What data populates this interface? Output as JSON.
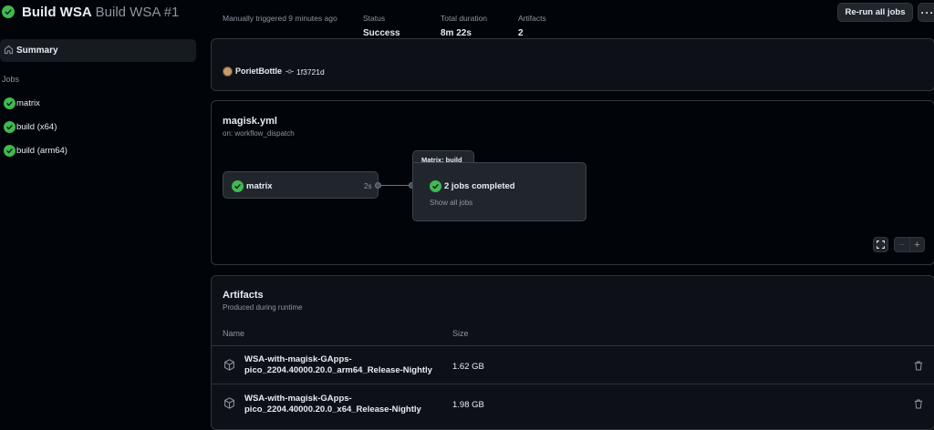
{
  "header": {
    "title": "Build WSA",
    "subtitle": "Build WSA #1",
    "rerun_label": "Re-run all jobs",
    "more_label": "···"
  },
  "sidebar": {
    "summary_label": "Summary",
    "jobs_heading": "Jobs",
    "jobs": [
      {
        "label": "matrix",
        "status": "success"
      },
      {
        "label": "build (x64)",
        "status": "success"
      },
      {
        "label": "build (arm64)",
        "status": "success"
      }
    ]
  },
  "run_info": {
    "trigger_label": "Manually triggered 9 minutes ago",
    "actor": "PorietBottle",
    "commit": "1f3721d",
    "status_label": "Status",
    "status_value": "Success",
    "duration_label": "Total duration",
    "duration_value": "8m 22s",
    "artifacts_label": "Artifacts",
    "artifacts_value": "2"
  },
  "workflow": {
    "file": "magisk.yml",
    "trigger": "on: workflow_dispatch",
    "job_node": {
      "label": "matrix",
      "duration": "2s"
    },
    "matrix": {
      "tab_label": "Matrix: build",
      "completed_label": "2 jobs completed",
      "show_all_label": "Show all jobs"
    },
    "controls": {
      "zoom_out": "−",
      "zoom_in": "+"
    }
  },
  "artifacts": {
    "title": "Artifacts",
    "subtitle": "Produced during runtime",
    "col_name": "Name",
    "col_size": "Size",
    "items": [
      {
        "name_line1": "WSA-with-magisk-GApps-",
        "name_line2": "pico_2204.40000.20.0_arm64_Release-Nightly",
        "size": "1.62 GB"
      },
      {
        "name_line1": "WSA-with-magisk-GApps-",
        "name_line2": "pico_2204.40000.20.0_x64_Release-Nightly",
        "size": "1.98 GB"
      }
    ]
  },
  "colors": {
    "success": "#3fb950",
    "background": "#010409",
    "panel": "#0d1117",
    "border": "#30363d"
  }
}
